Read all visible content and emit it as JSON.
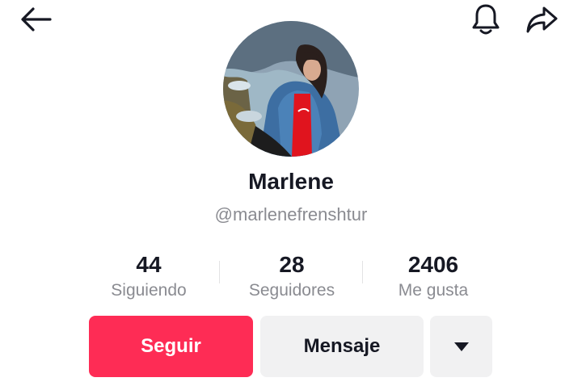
{
  "header": {
    "back_icon": "arrow-left-icon",
    "notify_icon": "bell-icon",
    "share_icon": "share-arrow-icon"
  },
  "profile": {
    "name": "Marlene",
    "handle": "@marlenefrenshtur"
  },
  "stats": [
    {
      "value": "44",
      "label": "Siguiendo"
    },
    {
      "value": "28",
      "label": "Seguidores"
    },
    {
      "value": "2406",
      "label": "Me gusta"
    }
  ],
  "actions": {
    "follow_label": "Seguir",
    "message_label": "Mensaje",
    "more_icon": "caret-down-icon"
  },
  "colors": {
    "accent": "#fe2c55",
    "secondary_button": "#f1f1f2",
    "muted_text": "#8a8b91",
    "primary_text": "#161823"
  }
}
